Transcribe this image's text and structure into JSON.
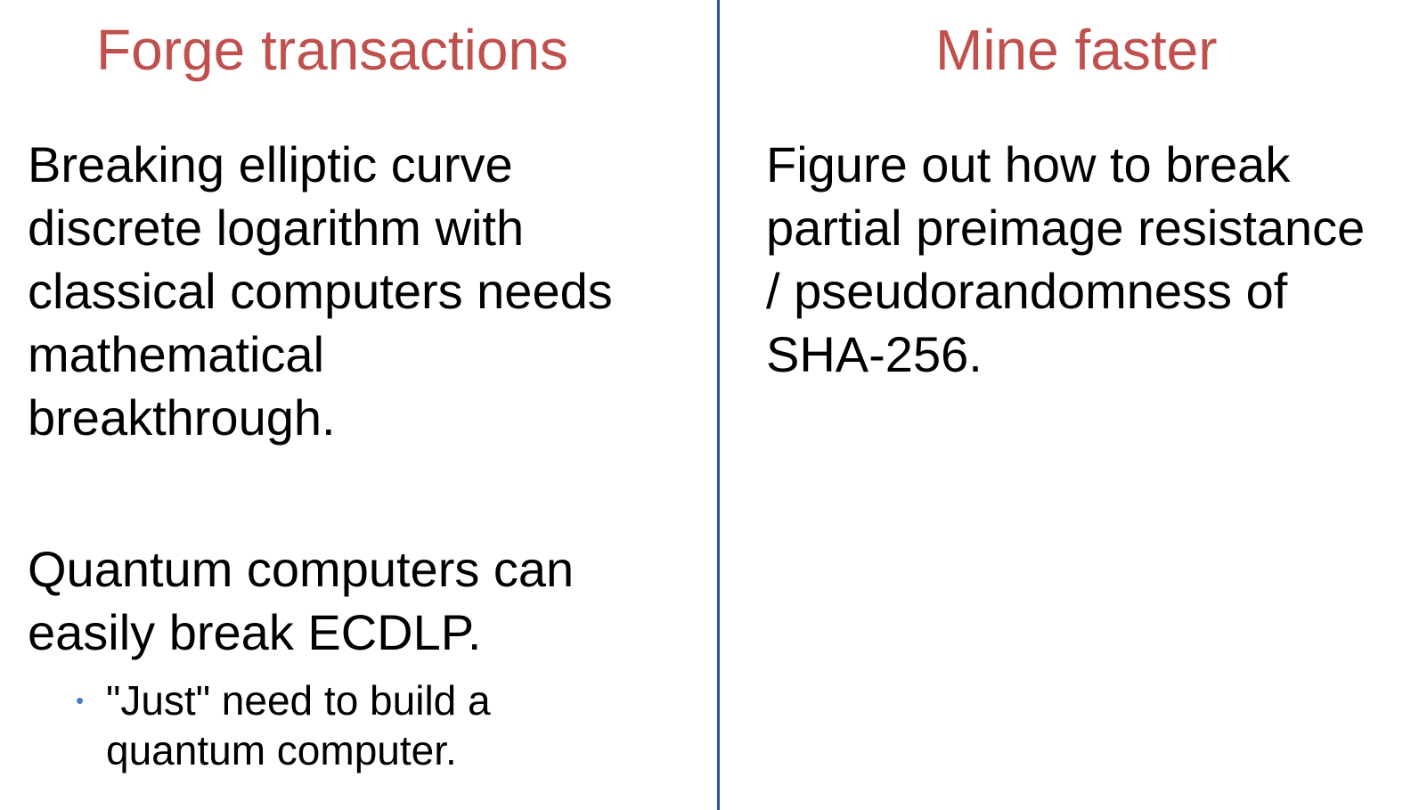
{
  "left_column": {
    "title": "Forge transactions",
    "paragraph_1": "Breaking elliptic curve\ndiscrete logarithm with\nclassical computers needs\nmathematical\nbreakthrough.",
    "paragraph_2": "Quantum computers can\neasily break ECDLP.",
    "bullet_symbol": "•",
    "bullet_text": "\"Just\" need to build a\nquantum computer."
  },
  "right_column": {
    "title": "Mine faster",
    "paragraph_1": "Figure out how to break\npartial preimage resistance\n/ pseudorandomness of\nSHA-256."
  },
  "colors": {
    "title": "#c0504d",
    "divider": "#2f5597",
    "bullet": "#4a7ebb",
    "text": "#000000"
  }
}
